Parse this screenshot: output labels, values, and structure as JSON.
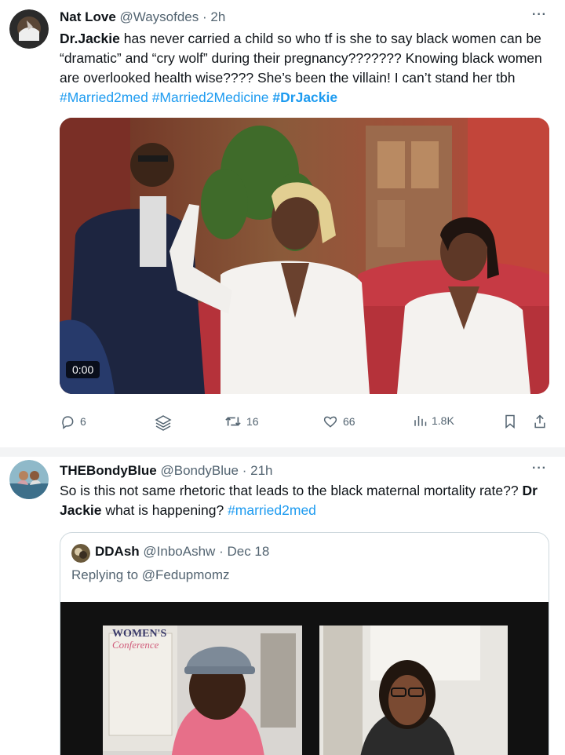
{
  "tweet1": {
    "display_name": "Nat Love",
    "handle": "@Waysofdes",
    "separator": "·",
    "time": "2h",
    "more_label": "···",
    "text_parts": {
      "p1_bold": "Dr.Jackie",
      "p2": " has never carried a child so who tf is she to say black women can be “dramatic” and “cry wolf” during their pregnancy??????? Knowing black women are overlooked health wise???? She’s been the villain! I can’t stand her tbh ",
      "tag1": "#Married2med",
      "sp1": " ",
      "tag2": "#Married2Medicine",
      "sp2": " ",
      "tag3": "#DrJackie"
    },
    "video_time": "0:00",
    "actions": {
      "replies": "6",
      "retweets": "16",
      "likes": "66",
      "views": "1.8K"
    }
  },
  "tweet2": {
    "display_name": "THEBondyBlue",
    "handle": "@BondyBlue",
    "separator": "·",
    "time": "21h",
    "more_label": "···",
    "text_parts": {
      "p1": "So is this not same rhetoric that leads to the black maternal mortality rate?? ",
      "p2_bold": "Dr Jackie",
      "p3": " what is happening? ",
      "tag1": "#married2med"
    },
    "quote": {
      "display_name": "DDAsh",
      "handle": "@InboAshw",
      "separator": "·",
      "date": "Dec 18",
      "replying_prefix": "Replying to ",
      "replying_handle": "@Fedupmomz",
      "sign_text_1": "WOMEN'S",
      "sign_text_2": "Conference"
    }
  },
  "colors": {
    "link": "#1d9bf0",
    "secondary": "#536471",
    "primary_text": "#0f1419",
    "divider": "#f3f4f5"
  },
  "icons": [
    "reply-icon",
    "grok-icon",
    "retweet-icon",
    "like-icon",
    "views-icon",
    "bookmark-icon",
    "share-icon",
    "more-icon"
  ]
}
